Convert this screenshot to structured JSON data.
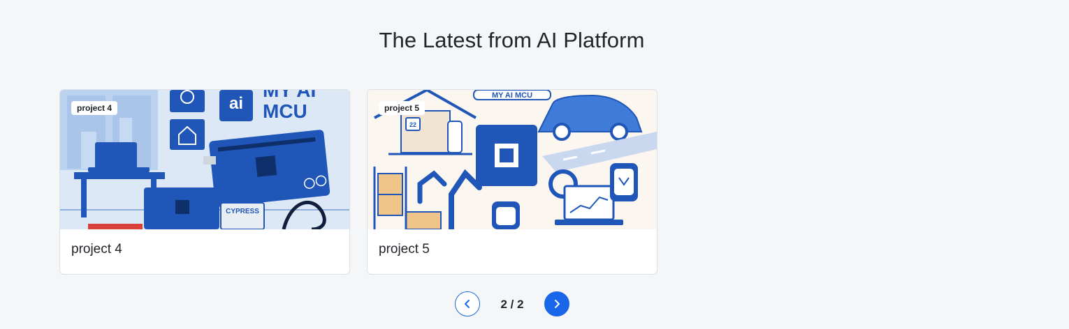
{
  "section": {
    "title": "The Latest from AI Platform"
  },
  "cards": [
    {
      "badge": "project 4",
      "title": "project 4",
      "image_labels": {
        "sign_line1": "MY AI",
        "sign_line2": "MCU",
        "chip_text": "ai",
        "brand": "CYPRESS"
      }
    },
    {
      "badge": "project 5",
      "title": "project 5",
      "image_labels": {
        "sign": "MY AI MCU",
        "thermostat": "22"
      }
    }
  ],
  "pager": {
    "status": "2 / 2",
    "prev_icon": "chevron-left-icon",
    "next_icon": "chevron-right-icon"
  },
  "colors": {
    "accent": "#1a66e8",
    "illustration_blue": "#1f56b8",
    "page_background": "#f5f6f7"
  }
}
